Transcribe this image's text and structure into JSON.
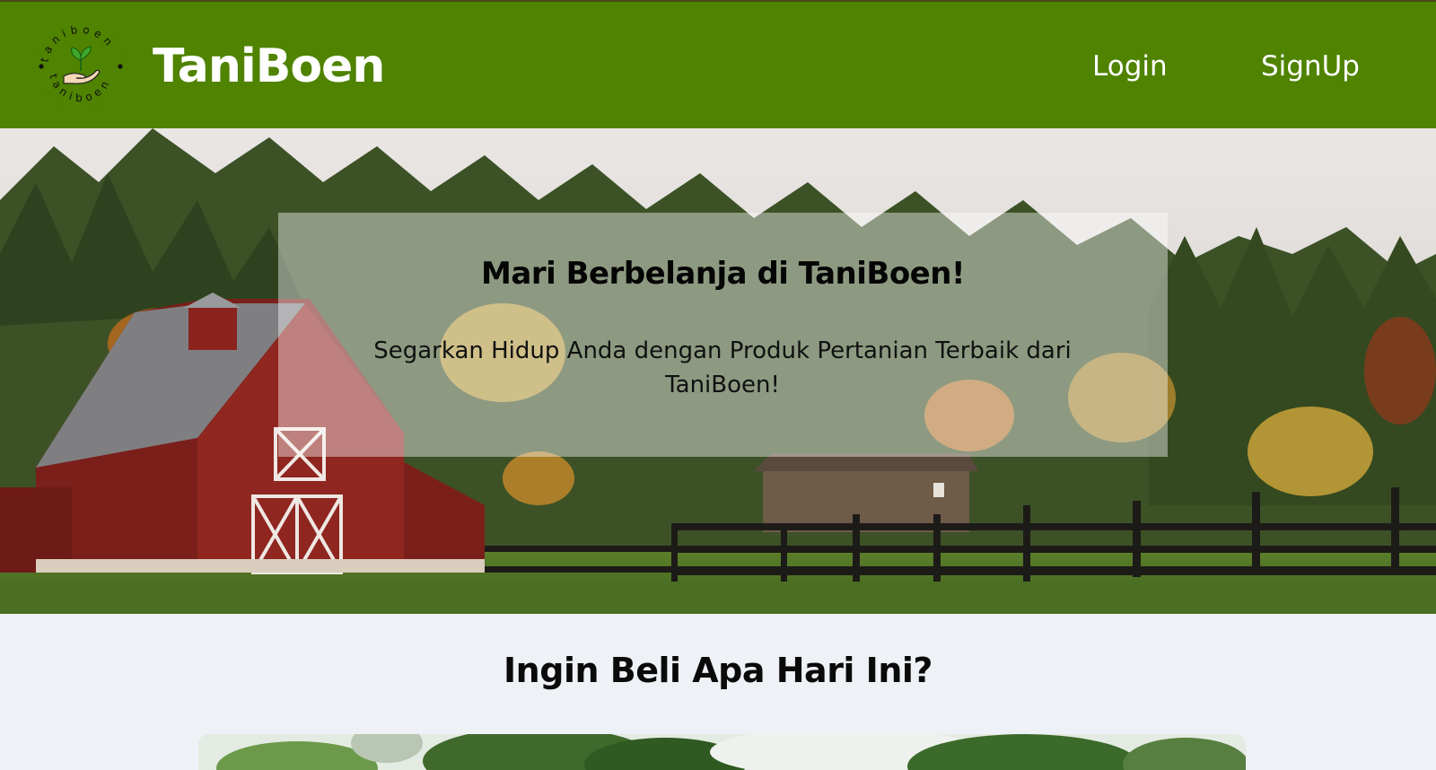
{
  "header": {
    "brand": "TaniBoen",
    "logo_ring_text": "taniboen",
    "nav": {
      "login_label": "Login",
      "signup_label": "SignUp"
    }
  },
  "hero": {
    "title": "Mari Berbelanja di TaniBoen!",
    "subtitle": "Segarkan Hidup Anda dengan Produk Pertanian Terbaik dari TaniBoen!"
  },
  "products_section": {
    "heading": "Ingin Beli Apa Hari Ini?"
  },
  "colors": {
    "header_bg": "#4f8300",
    "page_bg": "#eef1f5",
    "text_light": "#ffffff",
    "text_dark": "#050505"
  },
  "icons": {
    "logo": "sprout-in-hand-icon"
  }
}
